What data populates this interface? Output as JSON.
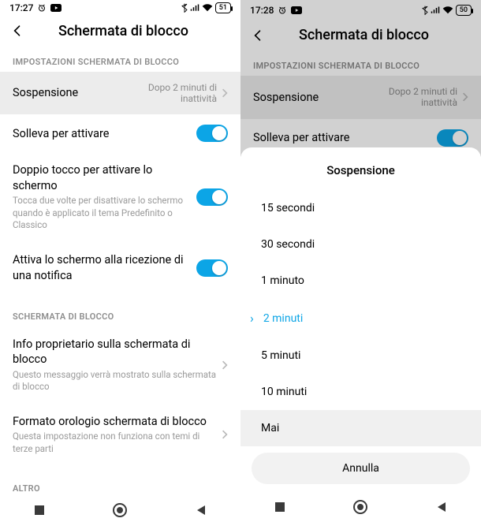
{
  "left": {
    "statusbar": {
      "time": "17:27",
      "battery": "51"
    },
    "header": {
      "title": "Schermata di blocco"
    },
    "section1": {
      "header": "IMPOSTAZIONI SCHERMATA DI BLOCCO",
      "sleep": {
        "label": "Sospensione",
        "value_line1": "Dopo 2 minuti di",
        "value_line2": "inattività"
      },
      "raise": {
        "label": "Solleva per attivare"
      },
      "doubletap": {
        "label": "Doppio tocco per attivare lo schermo",
        "desc": "Tocca due volte per disattivare lo schermo quando è applicato il tema Predefinito o Classico"
      },
      "wake_notify": {
        "label": "Attiva lo schermo alla ricezione di una notifica"
      }
    },
    "section2": {
      "header": "SCHERMATA DI BLOCCO",
      "owner": {
        "label": "Info proprietario sulla schermata di blocco",
        "desc": "Questo messaggio verrà mostrato sulla schermata di blocco"
      },
      "clock": {
        "label": "Formato orologio schermata di blocco",
        "desc": "Questa impostazione non funziona con temi di terze parti"
      }
    },
    "section3": {
      "header": "ALTRO"
    }
  },
  "right": {
    "statusbar": {
      "time": "17:28",
      "battery": "50"
    },
    "header": {
      "title": "Schermata di blocco"
    },
    "section1": {
      "header": "IMPOSTAZIONI SCHERMATA DI BLOCCO",
      "sleep": {
        "label": "Sospensione",
        "value_line1": "Dopo 2 minuti di",
        "value_line2": "inattività"
      },
      "raise": {
        "label": "Solleva per attivare"
      }
    },
    "sheet": {
      "title": "Sospensione",
      "options": [
        "15 secondi",
        "30 secondi",
        "1 minuto",
        "2 minuti",
        "5 minuti",
        "10 minuti",
        "Mai"
      ],
      "selected_index": 3,
      "highlighted_index": 6,
      "cancel": "Annulla"
    }
  }
}
